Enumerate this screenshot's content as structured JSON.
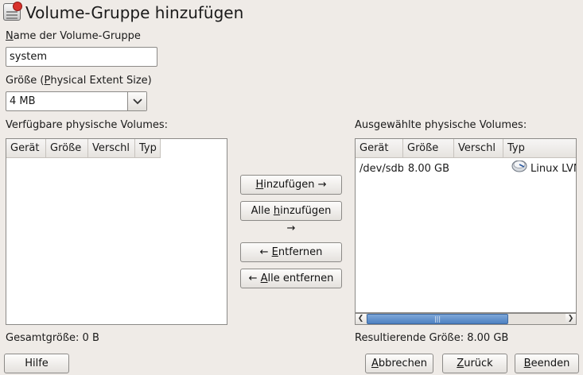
{
  "header": {
    "title": "Volume-Gruppe hinzufügen",
    "icon": "volume-group-icon"
  },
  "vg_name": {
    "label_prefix": "",
    "label_mnemonic": "N",
    "label_rest": "ame der Volume-Gruppe",
    "value": "system"
  },
  "extent_size": {
    "label_prefix": "Größe (",
    "label_mnemonic": "P",
    "label_rest": "hysical Extent Size)",
    "selected": "4 MB"
  },
  "available": {
    "label": "Verfügbare physische Volumes:",
    "columns": [
      "Gerät",
      "Größe",
      "Verschl",
      "Typ"
    ],
    "rows": [],
    "total_label": "Gesamtgröße: 0 B"
  },
  "selected": {
    "label": "Ausgewählte physische Volumes:",
    "columns": [
      "Gerät",
      "Größe",
      "Verschl",
      "Typ"
    ],
    "rows": [
      {
        "device": "/dev/sdb",
        "size": "8.00 GB",
        "locked": "",
        "type": "Linux LVM",
        "type_icon": "disk-icon"
      }
    ],
    "result_label": "Resultierende Größe: 8.00 GB"
  },
  "transfer_buttons": {
    "add": {
      "pre": "",
      "mn": "H",
      "post": "inzufügen →"
    },
    "add_all": {
      "pre": "Alle ",
      "mn": "h",
      "post": "inzufügen →"
    },
    "remove": {
      "pre": "← ",
      "mn": "E",
      "post": "ntfernen"
    },
    "remove_all": {
      "pre": "← ",
      "mn": "A",
      "post": "lle entfernen"
    }
  },
  "footer": {
    "help": "Hilfe",
    "cancel": {
      "mn": "A",
      "post": "bbrechen"
    },
    "back": {
      "mn": "Z",
      "post": "urück"
    },
    "finish": {
      "mn": "B",
      "post": "eenden"
    }
  },
  "colors": {
    "background": "#efebe7",
    "scroll_thumb": "#4f82c2"
  }
}
